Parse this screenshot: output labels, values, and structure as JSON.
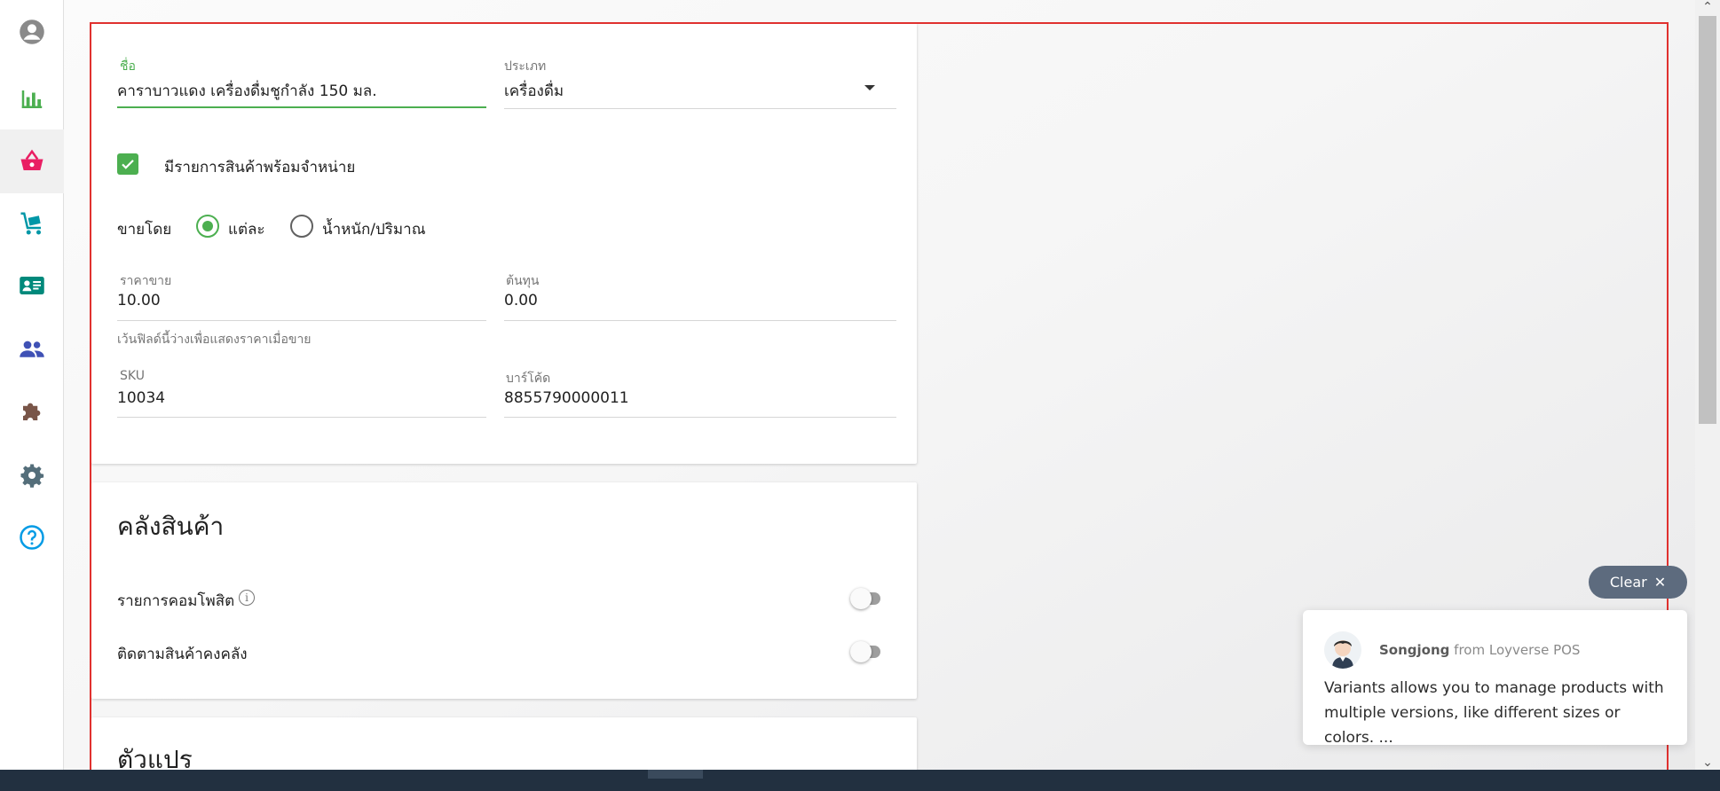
{
  "sidebar": {
    "items": [
      {
        "icon": "account-circle-icon",
        "color": "#757575"
      },
      {
        "icon": "bar-chart-icon",
        "color": "#4caf50"
      },
      {
        "icon": "basket-icon",
        "color": "#e91e63"
      },
      {
        "icon": "cart-icon",
        "color": "#0097a7"
      },
      {
        "icon": "contact-card-icon",
        "color": "#00897b"
      },
      {
        "icon": "people-icon",
        "color": "#3f51b5"
      },
      {
        "icon": "puzzle-icon",
        "color": "#795548"
      },
      {
        "icon": "gear-icon",
        "color": "#546e7a"
      },
      {
        "icon": "help-icon",
        "color": "#039be5"
      }
    ]
  },
  "form": {
    "name_label": "ชื่อ",
    "name_value": "คาราบาวแดง เครื่องดื่มชูกำลัง 150 มล.",
    "category_label": "ประเภท",
    "category_value": "เครื่องดื่ม",
    "available_label": "มีรายการสินค้าพร้อมจำหน่าย",
    "available_checked": true,
    "sold_by_label": "ขายโดย",
    "sold_by_options": [
      "แต่ละ",
      "น้ำหนัก/ปริมาณ"
    ],
    "sold_by_selected": "แต่ละ",
    "price_label": "ราคาขาย",
    "price_value": "10.00",
    "cost_label": "ต้นทุน",
    "cost_value": "0.00",
    "price_helper": "เว้นฟิลด์นี้ว่างเพื่อแสดงราคาเมื่อขาย",
    "sku_label": "SKU",
    "sku_value": "10034",
    "barcode_label": "บาร์โค้ด",
    "barcode_value": "8855790000011"
  },
  "inventory": {
    "title": "คลังสินค้า",
    "composite_label": "รายการคอมโพสิต",
    "composite_on": false,
    "track_stock_label": "ติดตามสินค้าคงคลัง",
    "track_stock_on": false
  },
  "variants": {
    "title": "ตัวแปร"
  },
  "chat": {
    "clear_label": "Clear",
    "sender_name": "Songjong",
    "sender_from": "from Loyverse POS",
    "message": "Variants allows you to manage products with multiple versions, like different sizes or colors. ..."
  },
  "colors": {
    "accent": "#4caf50",
    "highlight": "#e0312f"
  }
}
